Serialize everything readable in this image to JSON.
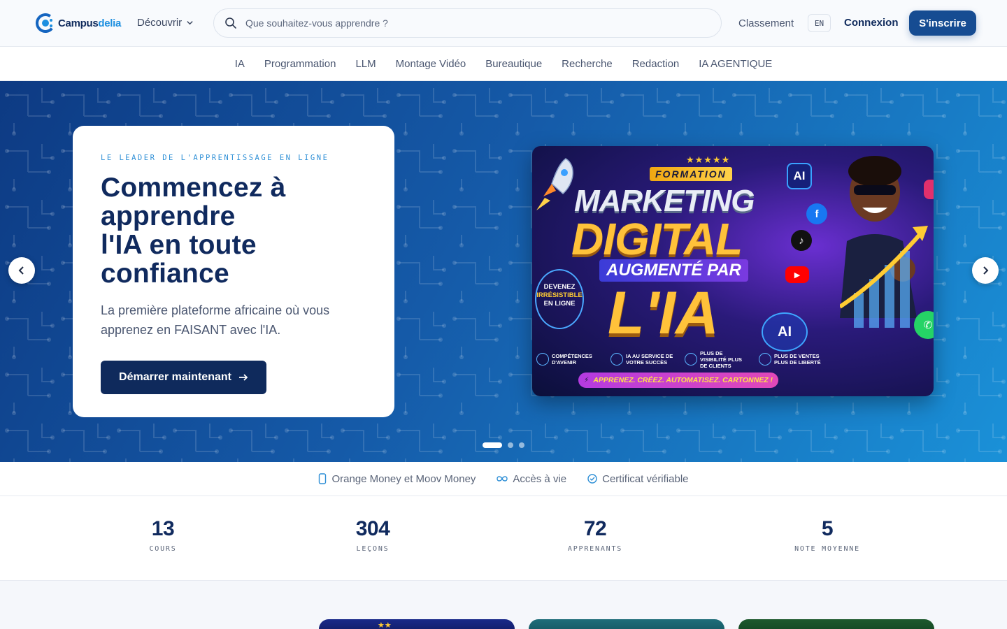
{
  "header": {
    "logo_brand": "Campus",
    "logo_accent": "delia",
    "discover_label": "Découvrir",
    "search_placeholder": "Que souhaitez-vous apprendre ?",
    "ranking_label": "Classement",
    "lang_label": "EN",
    "login_label": "Connexion",
    "signup_label": "S'inscrire"
  },
  "categories": [
    "IA",
    "Programmation",
    "LLM",
    "Montage Vidéo",
    "Bureautique",
    "Recherche",
    "Redaction",
    "IA AGENTIQUE"
  ],
  "hero": {
    "eyebrow": "LE LEADER DE L'APPRENTISSAGE EN LIGNE",
    "title_line1": "Commencez à",
    "title_line2": "apprendre",
    "title_line3": "l'IA en toute",
    "title_line4": "confiance",
    "subtitle": "La première plateforme africaine où vous apprenez en FAISANT avec l'IA.",
    "cta_label": "Démarrer maintenant",
    "slide_count": 3,
    "active_slide": 1
  },
  "promo": {
    "formation": "FORMATION",
    "stars": "★★★★★",
    "marketing": "MARKETING",
    "digital": "DIGITAL",
    "augmente": "AUGMENTÉ PAR",
    "ia": "L'IA",
    "devenez_1": "DEVENEZ",
    "devenez_2": "IRRÉSISTIBLE",
    "devenez_3": "EN LIGNE",
    "ai_badge": "AI",
    "ai_chip": "AI",
    "strip": [
      "COMPÉTENCES D'AVENIR",
      "IA AU SERVICE DE VOTRE SUCCÈS",
      "PLUS DE VISIBILITÉ PLUS DE CLIENTS",
      "PLUS DE VENTES PLUS DE LIBERTÉ"
    ],
    "banner": "APPRENEZ. CRÉEZ. AUTOMATISEZ. CARTONNEZ !"
  },
  "trust": {
    "payment": "Orange Money et Moov Money",
    "access": "Accès à vie",
    "certificate": "Certificat vérifiable"
  },
  "stats": [
    {
      "value": "13",
      "label": "COURS"
    },
    {
      "value": "304",
      "label": "LEÇONS"
    },
    {
      "value": "72",
      "label": "APPRENANTS"
    },
    {
      "value": "5",
      "label": "NOTE MOYENNE"
    }
  ],
  "colors": {
    "primary": "#0f2a5c",
    "accent": "#1d8fe0",
    "signup": "#164c92",
    "promo_gold": "#ffc23a"
  }
}
